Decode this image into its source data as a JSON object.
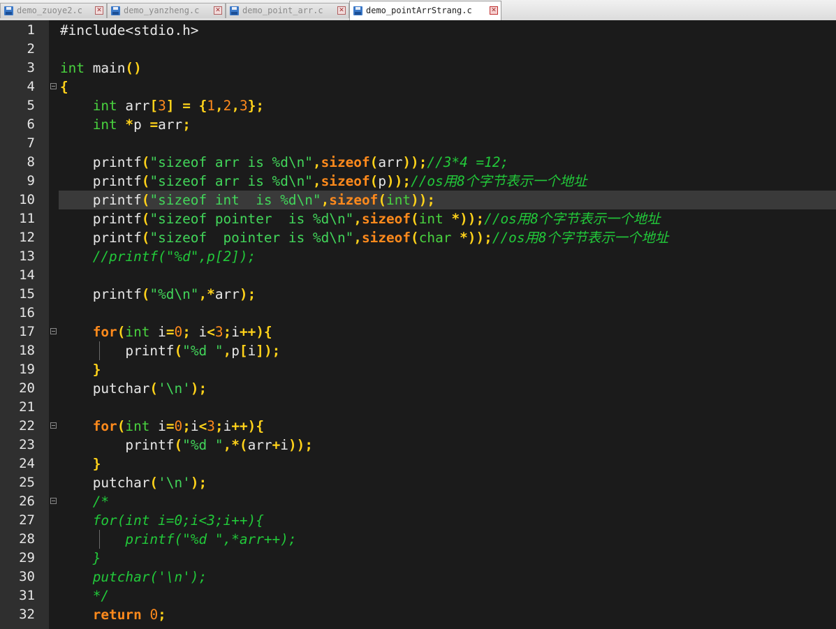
{
  "tabs": [
    {
      "label": "demo_zuoye2.c",
      "active": false
    },
    {
      "label": "demo_yanzheng.c",
      "active": false
    },
    {
      "label": "demo_point_arr.c",
      "active": false
    },
    {
      "label": "demo_pointArrStrang.c",
      "active": true
    }
  ],
  "close_glyph": "✕",
  "current_line": 10,
  "fold_lines": [
    4,
    17,
    22,
    26
  ],
  "colors": {
    "keyword": "#49d33f",
    "control": "#ff8a1c",
    "operator": "#ffd21a",
    "number": "#ff8a1c",
    "string": "#42d65a",
    "comment": "#22c93a",
    "text": "#e8e8e8",
    "background": "#1b1b1b",
    "gutter": "#2f2f2f"
  },
  "lines": [
    {
      "n": "1",
      "tokens": [
        [
          "pre",
          "#include<stdio.h>"
        ]
      ]
    },
    {
      "n": "2",
      "tokens": []
    },
    {
      "n": "3",
      "tokens": [
        [
          "kw",
          "int"
        ],
        [
          "plain",
          " main"
        ],
        [
          "op",
          "()"
        ]
      ]
    },
    {
      "n": "4",
      "tokens": [
        [
          "op",
          "{"
        ]
      ]
    },
    {
      "n": "5",
      "tokens": [
        [
          "plain",
          "    "
        ],
        [
          "kw",
          "int"
        ],
        [
          "plain",
          " arr"
        ],
        [
          "op",
          "["
        ],
        [
          "num",
          "3"
        ],
        [
          "op",
          "]"
        ],
        [
          "plain",
          " "
        ],
        [
          "op",
          "="
        ],
        [
          "plain",
          " "
        ],
        [
          "op",
          "{"
        ],
        [
          "num",
          "1"
        ],
        [
          "op",
          ","
        ],
        [
          "num",
          "2"
        ],
        [
          "op",
          ","
        ],
        [
          "num",
          "3"
        ],
        [
          "op",
          "};"
        ]
      ]
    },
    {
      "n": "6",
      "tokens": [
        [
          "plain",
          "    "
        ],
        [
          "kw",
          "int"
        ],
        [
          "plain",
          " "
        ],
        [
          "op",
          "*"
        ],
        [
          "plain",
          "p "
        ],
        [
          "op",
          "="
        ],
        [
          "plain",
          "arr"
        ],
        [
          "op",
          ";"
        ]
      ]
    },
    {
      "n": "7",
      "tokens": []
    },
    {
      "n": "8",
      "tokens": [
        [
          "plain",
          "    printf"
        ],
        [
          "op",
          "("
        ],
        [
          "str",
          "\"sizeof arr is %d\\n\""
        ],
        [
          "op",
          ","
        ],
        [
          "ctl",
          "sizeof"
        ],
        [
          "op",
          "("
        ],
        [
          "plain",
          "arr"
        ],
        [
          "op",
          "));"
        ],
        [
          "cm",
          "//3*4 =12;"
        ]
      ]
    },
    {
      "n": "9",
      "tokens": [
        [
          "plain",
          "    printf"
        ],
        [
          "op",
          "("
        ],
        [
          "str",
          "\"sizeof arr is %d\\n\""
        ],
        [
          "op",
          ","
        ],
        [
          "ctl",
          "sizeof"
        ],
        [
          "op",
          "("
        ],
        [
          "plain",
          "p"
        ],
        [
          "op",
          "));"
        ],
        [
          "cm",
          "//os用8个字节表示一个地址"
        ]
      ]
    },
    {
      "n": "10",
      "tokens": [
        [
          "plain",
          "    printf"
        ],
        [
          "op",
          "("
        ],
        [
          "str",
          "\"sizeof int  is %d\\n\""
        ],
        [
          "op",
          ","
        ],
        [
          "ctl",
          "sizeof"
        ],
        [
          "op",
          "("
        ],
        [
          "kw",
          "int"
        ],
        [
          "op",
          "));"
        ]
      ]
    },
    {
      "n": "11",
      "tokens": [
        [
          "plain",
          "    printf"
        ],
        [
          "op",
          "("
        ],
        [
          "str",
          "\"sizeof pointer  is %d\\n\""
        ],
        [
          "op",
          ","
        ],
        [
          "ctl",
          "sizeof"
        ],
        [
          "op",
          "("
        ],
        [
          "kw",
          "int"
        ],
        [
          "plain",
          " "
        ],
        [
          "op",
          "*));"
        ],
        [
          "cm",
          "//os用8个字节表示一个地址"
        ]
      ]
    },
    {
      "n": "12",
      "tokens": [
        [
          "plain",
          "    printf"
        ],
        [
          "op",
          "("
        ],
        [
          "str",
          "\"sizeof  pointer is %d\\n\""
        ],
        [
          "op",
          ","
        ],
        [
          "ctl",
          "sizeof"
        ],
        [
          "op",
          "("
        ],
        [
          "kw",
          "char"
        ],
        [
          "plain",
          " "
        ],
        [
          "op",
          "*));"
        ],
        [
          "cm",
          "//os用8个字节表示一个地址"
        ]
      ]
    },
    {
      "n": "13",
      "tokens": [
        [
          "plain",
          "    "
        ],
        [
          "cm",
          "//printf(\"%d\",p[2]);"
        ]
      ]
    },
    {
      "n": "14",
      "tokens": []
    },
    {
      "n": "15",
      "tokens": [
        [
          "plain",
          "    printf"
        ],
        [
          "op",
          "("
        ],
        [
          "str",
          "\"%d\\n\""
        ],
        [
          "op",
          ","
        ],
        [
          "op",
          "*"
        ],
        [
          "plain",
          "arr"
        ],
        [
          "op",
          ");"
        ]
      ]
    },
    {
      "n": "16",
      "tokens": []
    },
    {
      "n": "17",
      "tokens": [
        [
          "plain",
          "    "
        ],
        [
          "ctl",
          "for"
        ],
        [
          "op",
          "("
        ],
        [
          "kw",
          "int"
        ],
        [
          "plain",
          " i"
        ],
        [
          "op",
          "="
        ],
        [
          "num",
          "0"
        ],
        [
          "op",
          ";"
        ],
        [
          "plain",
          " i"
        ],
        [
          "op",
          "<"
        ],
        [
          "num",
          "3"
        ],
        [
          "op",
          ";"
        ],
        [
          "plain",
          "i"
        ],
        [
          "op",
          "++){"
        ]
      ]
    },
    {
      "n": "18",
      "tokens": [
        [
          "plain",
          "        printf"
        ],
        [
          "op",
          "("
        ],
        [
          "str",
          "\"%d \""
        ],
        [
          "op",
          ","
        ],
        [
          "plain",
          "p"
        ],
        [
          "op",
          "["
        ],
        [
          "plain",
          "i"
        ],
        [
          "op",
          "]);"
        ]
      ]
    },
    {
      "n": "19",
      "tokens": [
        [
          "plain",
          "    "
        ],
        [
          "op",
          "}"
        ]
      ]
    },
    {
      "n": "20",
      "tokens": [
        [
          "plain",
          "    putchar"
        ],
        [
          "op",
          "("
        ],
        [
          "str",
          "'\\n'"
        ],
        [
          "op",
          ");"
        ]
      ]
    },
    {
      "n": "21",
      "tokens": []
    },
    {
      "n": "22",
      "tokens": [
        [
          "plain",
          "    "
        ],
        [
          "ctl",
          "for"
        ],
        [
          "op",
          "("
        ],
        [
          "kw",
          "int"
        ],
        [
          "plain",
          " i"
        ],
        [
          "op",
          "="
        ],
        [
          "num",
          "0"
        ],
        [
          "op",
          ";"
        ],
        [
          "plain",
          "i"
        ],
        [
          "op",
          "<"
        ],
        [
          "num",
          "3"
        ],
        [
          "op",
          ";"
        ],
        [
          "plain",
          "i"
        ],
        [
          "op",
          "++){"
        ]
      ]
    },
    {
      "n": "23",
      "tokens": [
        [
          "plain",
          "        printf"
        ],
        [
          "op",
          "("
        ],
        [
          "str",
          "\"%d \""
        ],
        [
          "op",
          ","
        ],
        [
          "op",
          "*("
        ],
        [
          "plain",
          "arr"
        ],
        [
          "op",
          "+"
        ],
        [
          "plain",
          "i"
        ],
        [
          "op",
          "));"
        ]
      ]
    },
    {
      "n": "24",
      "tokens": [
        [
          "plain",
          "    "
        ],
        [
          "op",
          "}"
        ]
      ]
    },
    {
      "n": "25",
      "tokens": [
        [
          "plain",
          "    putchar"
        ],
        [
          "op",
          "("
        ],
        [
          "str",
          "'\\n'"
        ],
        [
          "op",
          ");"
        ]
      ]
    },
    {
      "n": "26",
      "tokens": [
        [
          "plain",
          "    "
        ],
        [
          "cm",
          "/*"
        ]
      ]
    },
    {
      "n": "27",
      "tokens": [
        [
          "plain",
          "    "
        ],
        [
          "cm",
          "for(int i=0;i<3;i++){"
        ]
      ]
    },
    {
      "n": "28",
      "tokens": [
        [
          "plain",
          "        "
        ],
        [
          "cm",
          "printf(\"%d \",*arr++);"
        ]
      ]
    },
    {
      "n": "29",
      "tokens": [
        [
          "plain",
          "    "
        ],
        [
          "cm",
          "}"
        ]
      ]
    },
    {
      "n": "30",
      "tokens": [
        [
          "plain",
          "    "
        ],
        [
          "cm",
          "putchar('\\n');"
        ]
      ]
    },
    {
      "n": "31",
      "tokens": [
        [
          "plain",
          "    "
        ],
        [
          "cm",
          "*/"
        ]
      ]
    },
    {
      "n": "32",
      "tokens": [
        [
          "plain",
          "    "
        ],
        [
          "ctl",
          "return"
        ],
        [
          "plain",
          " "
        ],
        [
          "num",
          "0"
        ],
        [
          "op",
          ";"
        ]
      ]
    }
  ]
}
